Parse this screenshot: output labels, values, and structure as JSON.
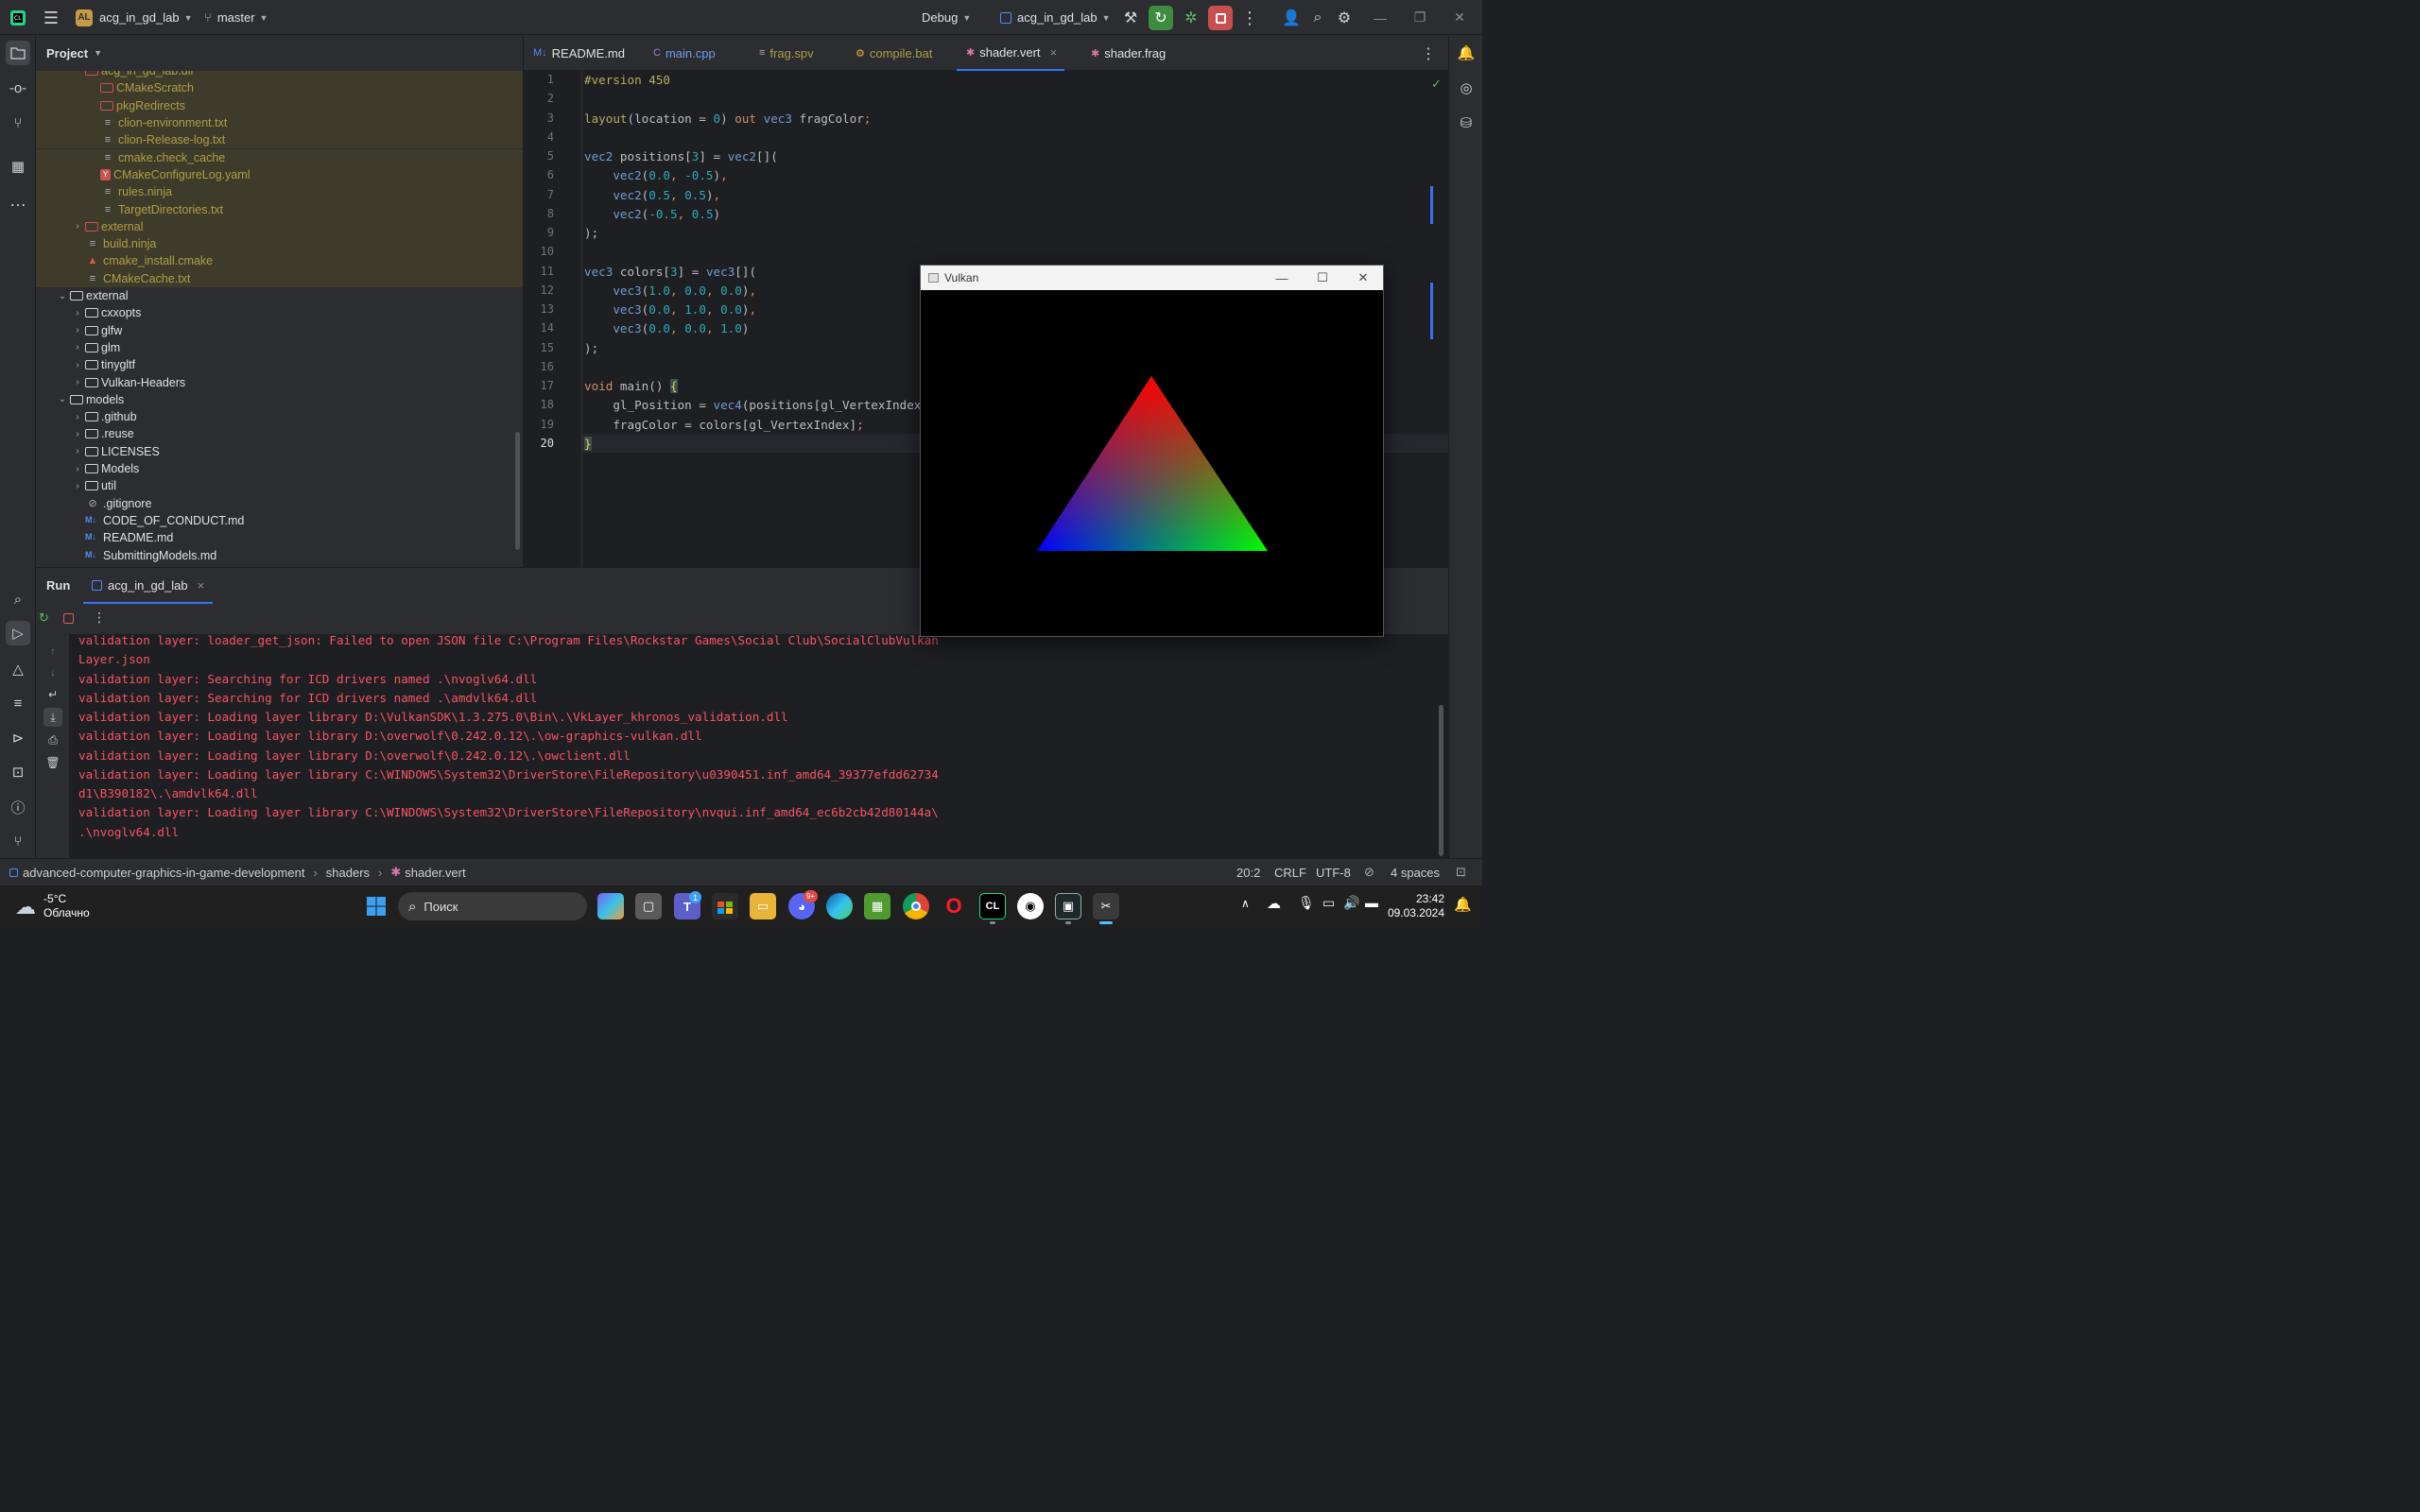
{
  "titlebar": {
    "project_badge": "AL",
    "project_name": "acg_in_gd_lab",
    "branch": "master",
    "build_config": "Debug",
    "run_config": "acg_in_gd_lab"
  },
  "project_panel": {
    "title": "Project",
    "rows": [
      {
        "label": "acg_in_gd_lab.dir",
        "indent": 3,
        "kind": "folder-red",
        "excluded": true,
        "arrow": ""
      },
      {
        "label": "CMakeScratch",
        "indent": 4,
        "kind": "folder-red",
        "excluded": true,
        "arrow": ""
      },
      {
        "label": "pkgRedirects",
        "indent": 4,
        "kind": "folder-red",
        "excluded": true,
        "arrow": ""
      },
      {
        "label": "clion-environment.txt",
        "indent": 4,
        "kind": "text",
        "excluded": true,
        "arrow": ""
      },
      {
        "label": "clion-Release-log.txt",
        "indent": 4,
        "kind": "text",
        "excluded": true,
        "arrow": ""
      },
      {
        "label": "cmake.check_cache",
        "indent": 4,
        "kind": "text",
        "excluded": true,
        "arrow": ""
      },
      {
        "label": "CMakeConfigureLog.yaml",
        "indent": 4,
        "kind": "yaml",
        "excluded": true,
        "arrow": ""
      },
      {
        "label": "rules.ninja",
        "indent": 4,
        "kind": "text",
        "excluded": true,
        "arrow": ""
      },
      {
        "label": "TargetDirectories.txt",
        "indent": 4,
        "kind": "text",
        "excluded": true,
        "arrow": ""
      },
      {
        "label": "external",
        "indent": 3,
        "kind": "folder-red",
        "excluded": true,
        "arrow": "›"
      },
      {
        "label": "build.ninja",
        "indent": 3,
        "kind": "text",
        "excluded": true,
        "arrow": ""
      },
      {
        "label": "cmake_install.cmake",
        "indent": 3,
        "kind": "cmake",
        "excluded": true,
        "arrow": ""
      },
      {
        "label": "CMakeCache.txt",
        "indent": 3,
        "kind": "text",
        "excluded": true,
        "arrow": ""
      },
      {
        "label": "external",
        "indent": 2,
        "kind": "folder",
        "excluded": false,
        "arrow": "⌄"
      },
      {
        "label": "cxxopts",
        "indent": 3,
        "kind": "folder",
        "excluded": false,
        "arrow": "›"
      },
      {
        "label": "glfw",
        "indent": 3,
        "kind": "folder",
        "excluded": false,
        "arrow": "›"
      },
      {
        "label": "glm",
        "indent": 3,
        "kind": "folder",
        "excluded": false,
        "arrow": "›"
      },
      {
        "label": "tinygltf",
        "indent": 3,
        "kind": "folder",
        "excluded": false,
        "arrow": "›"
      },
      {
        "label": "Vulkan-Headers",
        "indent": 3,
        "kind": "folder",
        "excluded": false,
        "arrow": "›"
      },
      {
        "label": "models",
        "indent": 2,
        "kind": "folder",
        "excluded": false,
        "arrow": "⌄"
      },
      {
        "label": ".github",
        "indent": 3,
        "kind": "folder",
        "excluded": false,
        "arrow": "›"
      },
      {
        "label": ".reuse",
        "indent": 3,
        "kind": "folder",
        "excluded": false,
        "arrow": "›"
      },
      {
        "label": "LICENSES",
        "indent": 3,
        "kind": "folder",
        "excluded": false,
        "arrow": "›"
      },
      {
        "label": "Models",
        "indent": 3,
        "kind": "folder",
        "excluded": false,
        "arrow": "›"
      },
      {
        "label": "util",
        "indent": 3,
        "kind": "folder",
        "excluded": false,
        "arrow": "›"
      },
      {
        "label": ".gitignore",
        "indent": 3,
        "kind": "ignore",
        "excluded": false,
        "arrow": ""
      },
      {
        "label": "CODE_OF_CONDUCT.md",
        "indent": 3,
        "kind": "md",
        "excluded": false,
        "arrow": ""
      },
      {
        "label": "README.md",
        "indent": 3,
        "kind": "md",
        "excluded": false,
        "arrow": ""
      },
      {
        "label": "SubmittingModels.md",
        "indent": 3,
        "kind": "md",
        "excluded": false,
        "arrow": ""
      }
    ]
  },
  "editor": {
    "tabs": [
      {
        "label": "README.md",
        "icon": "M↓",
        "style": "normal"
      },
      {
        "label": "main.cpp",
        "icon": "C",
        "style": "blueish"
      },
      {
        "label": "frag.spv",
        "icon": "≡",
        "style": "yellow"
      },
      {
        "label": "compile.bat",
        "icon": "⚙",
        "style": "yellow"
      },
      {
        "label": "shader.vert",
        "icon": "✱",
        "style": "active"
      },
      {
        "label": "shader.frag",
        "icon": "✱",
        "style": "normal"
      }
    ],
    "tab_close": "×",
    "lines": [
      [
        {
          "t": "#version 450",
          "c": "pre"
        }
      ],
      [],
      [
        {
          "t": "layout",
          "c": "pre"
        },
        {
          "t": "(location = ",
          "c": ""
        },
        {
          "t": "0",
          "c": "num"
        },
        {
          "t": ") ",
          "c": ""
        },
        {
          "t": "out",
          "c": "kw"
        },
        {
          "t": " ",
          "c": ""
        },
        {
          "t": "vec3",
          "c": "ty"
        },
        {
          "t": " fragColor",
          "c": ""
        },
        {
          "t": ";",
          "c": "kw"
        }
      ],
      [],
      [
        {
          "t": "vec2",
          "c": "ty"
        },
        {
          "t": " positions[",
          "c": ""
        },
        {
          "t": "3",
          "c": "num"
        },
        {
          "t": "] = ",
          "c": ""
        },
        {
          "t": "vec2",
          "c": "ty"
        },
        {
          "t": "[](",
          "c": ""
        }
      ],
      [
        {
          "t": "    vec2",
          "c": "ty"
        },
        {
          "t": "(",
          "c": ""
        },
        {
          "t": "0.0",
          "c": "num"
        },
        {
          "t": ", ",
          "c": "kw"
        },
        {
          "t": "-0.5",
          "c": "num"
        },
        {
          "t": ")",
          "c": ""
        },
        {
          "t": ",",
          "c": "kw"
        }
      ],
      [
        {
          "t": "    vec2",
          "c": "ty"
        },
        {
          "t": "(",
          "c": ""
        },
        {
          "t": "0.5",
          "c": "num"
        },
        {
          "t": ", ",
          "c": "kw"
        },
        {
          "t": "0.5",
          "c": "num"
        },
        {
          "t": ")",
          "c": ""
        },
        {
          "t": ",",
          "c": "kw"
        }
      ],
      [
        {
          "t": "    vec2",
          "c": "ty"
        },
        {
          "t": "(",
          "c": ""
        },
        {
          "t": "-0.5",
          "c": "num"
        },
        {
          "t": ", ",
          "c": "kw"
        },
        {
          "t": "0.5",
          "c": "num"
        },
        {
          "t": ")",
          "c": ""
        }
      ],
      [
        {
          "t": ");",
          "c": ""
        }
      ],
      [],
      [
        {
          "t": "vec3",
          "c": "ty"
        },
        {
          "t": " colors[",
          "c": ""
        },
        {
          "t": "3",
          "c": "num"
        },
        {
          "t": "] = ",
          "c": ""
        },
        {
          "t": "vec3",
          "c": "ty"
        },
        {
          "t": "[](",
          "c": ""
        }
      ],
      [
        {
          "t": "    vec3",
          "c": "ty"
        },
        {
          "t": "(",
          "c": ""
        },
        {
          "t": "1.0",
          "c": "num"
        },
        {
          "t": ", ",
          "c": "kw"
        },
        {
          "t": "0.0",
          "c": "num"
        },
        {
          "t": ", ",
          "c": "kw"
        },
        {
          "t": "0.0",
          "c": "num"
        },
        {
          "t": ")",
          "c": ""
        },
        {
          "t": ",",
          "c": "kw"
        }
      ],
      [
        {
          "t": "    vec3",
          "c": "ty"
        },
        {
          "t": "(",
          "c": ""
        },
        {
          "t": "0.0",
          "c": "num"
        },
        {
          "t": ", ",
          "c": "kw"
        },
        {
          "t": "1.0",
          "c": "num"
        },
        {
          "t": ", ",
          "c": "kw"
        },
        {
          "t": "0.0",
          "c": "num"
        },
        {
          "t": ")",
          "c": ""
        },
        {
          "t": ",",
          "c": "kw"
        }
      ],
      [
        {
          "t": "    vec3",
          "c": "ty"
        },
        {
          "t": "(",
          "c": ""
        },
        {
          "t": "0.0",
          "c": "num"
        },
        {
          "t": ", ",
          "c": "kw"
        },
        {
          "t": "0.0",
          "c": "num"
        },
        {
          "t": ", ",
          "c": "kw"
        },
        {
          "t": "1.0",
          "c": "num"
        },
        {
          "t": ")",
          "c": ""
        }
      ],
      [
        {
          "t": ");",
          "c": ""
        }
      ],
      [],
      [
        {
          "t": "void",
          "c": "kw"
        },
        {
          "t": " main() ",
          "c": ""
        },
        {
          "t": "{",
          "c": "brace"
        }
      ],
      [
        {
          "t": "    gl_Position = ",
          "c": ""
        },
        {
          "t": "vec4",
          "c": "ty"
        },
        {
          "t": "(positions[gl_VertexIndex]",
          "c": ""
        }
      ],
      [
        {
          "t": "    fragColor = colors[gl_VertexIndex]",
          "c": ""
        },
        {
          "t": ";",
          "c": "kw"
        }
      ],
      [
        {
          "t": "}",
          "c": "brace"
        }
      ]
    ]
  },
  "vulkan_window": {
    "title": "Vulkan",
    "minimize": "—",
    "maximize": "☐",
    "close": "✕"
  },
  "run_panel": {
    "label": "Run",
    "tab": "acg_in_gd_lab",
    "close": "×",
    "console_lines": [
      "validation layer: loader_get_json: Failed to open JSON file C:\\Program Files\\Rockstar Games\\Social Club\\SocialClubVulkan",
      "Layer.json",
      "validation layer: Searching for ICD drivers named .\\nvoglv64.dll",
      "validation layer: Searching for ICD drivers named .\\amdvlk64.dll",
      "validation layer: Loading layer library D:\\VulkanSDK\\1.3.275.0\\Bin\\.\\VkLayer_khronos_validation.dll",
      "validation layer: Loading layer library D:\\overwolf\\0.242.0.12\\.\\ow-graphics-vulkan.dll",
      "validation layer: Loading layer library D:\\overwolf\\0.242.0.12\\.\\owclient.dll",
      "validation layer: Loading layer library C:\\WINDOWS\\System32\\DriverStore\\FileRepository\\u0390451.inf_amd64_39377efdd62734",
      "d1\\B390182\\.\\amdvlk64.dll",
      "validation layer: Loading layer library C:\\WINDOWS\\System32\\DriverStore\\FileRepository\\nvqui.inf_amd64_ec6b2cb42d80144a\\",
      ".\\nvoglv64.dll"
    ]
  },
  "statusbar": {
    "crumbs": [
      "advanced-computer-graphics-in-game-development",
      "shaders",
      "shader.vert"
    ],
    "position": "20:2",
    "line_sep": "CRLF",
    "encoding": "UTF-8",
    "indent": "4 spaces"
  },
  "taskbar": {
    "weather_temp": "-5°C",
    "weather_desc": "Облачно",
    "search_placeholder": "Поиск",
    "time": "23:42",
    "date": "09.03.2024",
    "teams_badge": "1",
    "discord_badge": "9+"
  },
  "colors": {
    "accent": "#3574f0",
    "run_green": "#4caf50",
    "stop_red": "#db5c5c",
    "error_text": "#f75464",
    "excluded_bg": "#3e3b2a"
  }
}
